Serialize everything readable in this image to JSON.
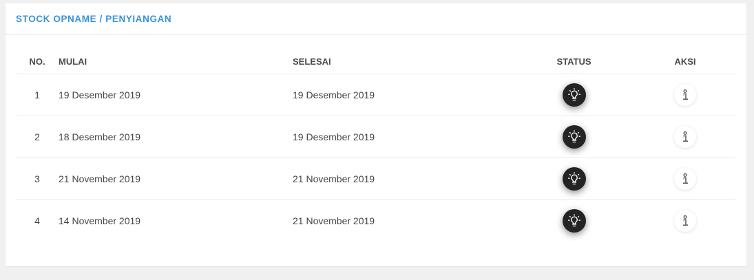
{
  "card": {
    "title": "STOCK OPNAME / PENYIANGAN"
  },
  "table": {
    "headers": {
      "no": "NO.",
      "mulai": "MULAI",
      "selesai": "SELESAI",
      "status": "STATUS",
      "aksi": "AKSI"
    },
    "rows": [
      {
        "no": "1",
        "mulai": "19 Desember 2019",
        "selesai": "19 Desember 2019",
        "status_icon": "lightbulb-icon",
        "aksi_icon": "info-icon"
      },
      {
        "no": "2",
        "mulai": "18 Desember 2019",
        "selesai": "19 Desember 2019",
        "status_icon": "lightbulb-icon",
        "aksi_icon": "info-icon"
      },
      {
        "no": "3",
        "mulai": "21 November 2019",
        "selesai": "21 November 2019",
        "status_icon": "lightbulb-icon",
        "aksi_icon": "info-icon"
      },
      {
        "no": "4",
        "mulai": "14 November 2019",
        "selesai": "21 November 2019",
        "status_icon": "lightbulb-icon",
        "aksi_icon": "info-icon"
      }
    ]
  },
  "colors": {
    "title": "#3793d8",
    "status_button": "#242424",
    "background": "#f0f0f0"
  }
}
